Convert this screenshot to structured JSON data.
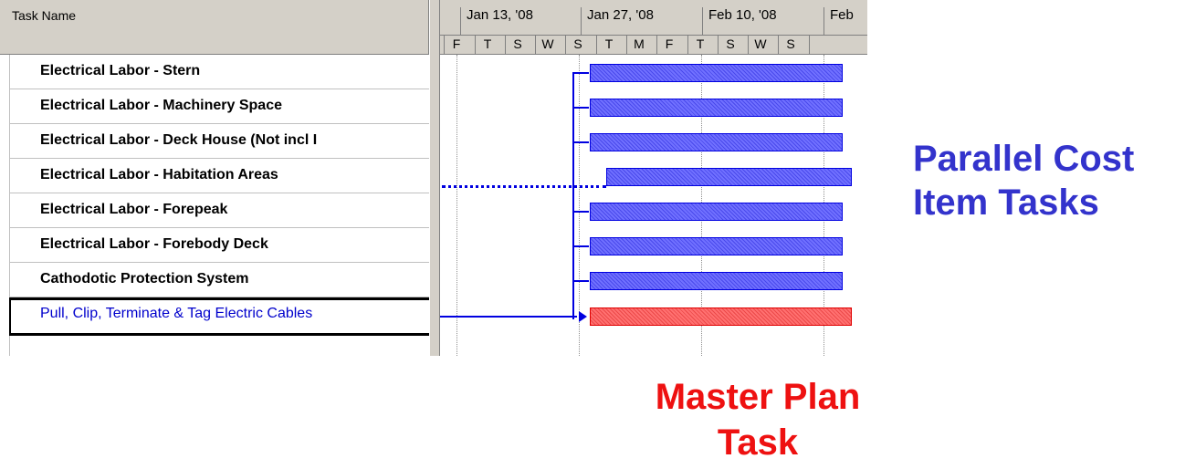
{
  "table": {
    "header": "Task Name",
    "tasks": [
      {
        "name": "Electrical Labor - Stern"
      },
      {
        "name": "Electrical Labor - Machinery Space"
      },
      {
        "name": "Electrical Labor - Deck House (Not incl I"
      },
      {
        "name": "Electrical Labor - Habitation Areas"
      },
      {
        "name": "Electrical Labor - Forepeak"
      },
      {
        "name": "Electrical Labor - Forebody Deck"
      },
      {
        "name": "Cathodotic Protection System"
      },
      {
        "name": "Pull, Clip, Terminate & Tag Electric Cables"
      }
    ]
  },
  "timescale": {
    "major": [
      "Jan 13, '08",
      "Jan 27, '08",
      "Feb 10, '08",
      "Feb"
    ],
    "minor": [
      "F",
      "T",
      "S",
      "W",
      "S",
      "T",
      "M",
      "F",
      "T",
      "S",
      "W",
      "S"
    ]
  },
  "annotations": {
    "parallel_line1": "Parallel Cost",
    "parallel_line2": "Item Tasks",
    "master_line1": "Master Plan",
    "master_line2": "Task"
  },
  "colors": {
    "parallel_bar": "#7070ff",
    "master_bar": "#ff7070",
    "link": "#0000e0",
    "annotation_blue": "#3333cc",
    "annotation_red": "#ee1111"
  }
}
